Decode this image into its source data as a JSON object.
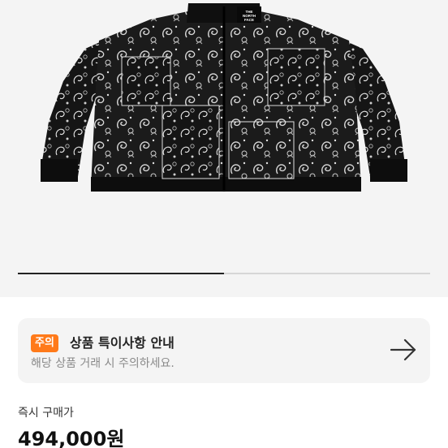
{
  "product": {
    "image_alt": "검정 페이즐리 반다나 패턴 패딩 재킷",
    "logo_text": "THE NORTH FACE"
  },
  "carousel": {
    "total_slides": 2,
    "active_slide": 1
  },
  "notice": {
    "badge": "주의",
    "title": "상품 특이사항 안내",
    "subtitle": "해당 상품 거래 시 주의하세요.",
    "icon": "arrow-right-icon"
  },
  "purchase": {
    "label": "즉시 구매가",
    "price": "494,000원"
  },
  "colors": {
    "badge": "#ff7a1a",
    "card_bg": "#f4f4f4",
    "image_bg": "#f4f4f4"
  }
}
